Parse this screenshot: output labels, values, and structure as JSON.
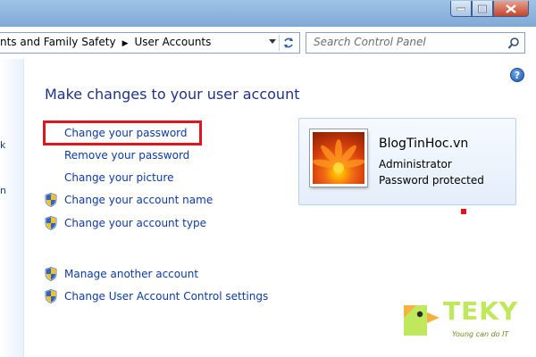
{
  "address_bar": {
    "breadcrumbs": [
      "nts and Family Safety",
      "User Accounts"
    ]
  },
  "search": {
    "placeholder": "Search Control Panel"
  },
  "left_pane": {
    "fragments": [
      "k",
      "n"
    ]
  },
  "main": {
    "heading": "Make changes to your user account",
    "links": [
      "Change your password",
      "Remove your password",
      "Change your picture",
      "Change your account name",
      "Change your account type"
    ],
    "other_links": [
      "Manage another account",
      "Change User Account Control settings"
    ],
    "help_icon": "?"
  },
  "user": {
    "name": "BlogTinHoc.vn",
    "role": "Administrator",
    "status": "Password protected"
  },
  "watermark": {
    "brand": "TEKY",
    "tagline": "Young can do IT"
  },
  "colors": {
    "link": "#0c3aa3",
    "heading": "#1e3287",
    "highlight": "#e3141b",
    "titlebar": "#9fc3e6",
    "logo": "#bfe85c"
  },
  "icons": [
    "minimize-icon",
    "maximize-icon",
    "close-icon",
    "dropdown-arrow-icon",
    "refresh-icon",
    "search-icon",
    "help-icon",
    "uac-shield-icon",
    "user-avatar-flower",
    "teky-duck-logo"
  ]
}
